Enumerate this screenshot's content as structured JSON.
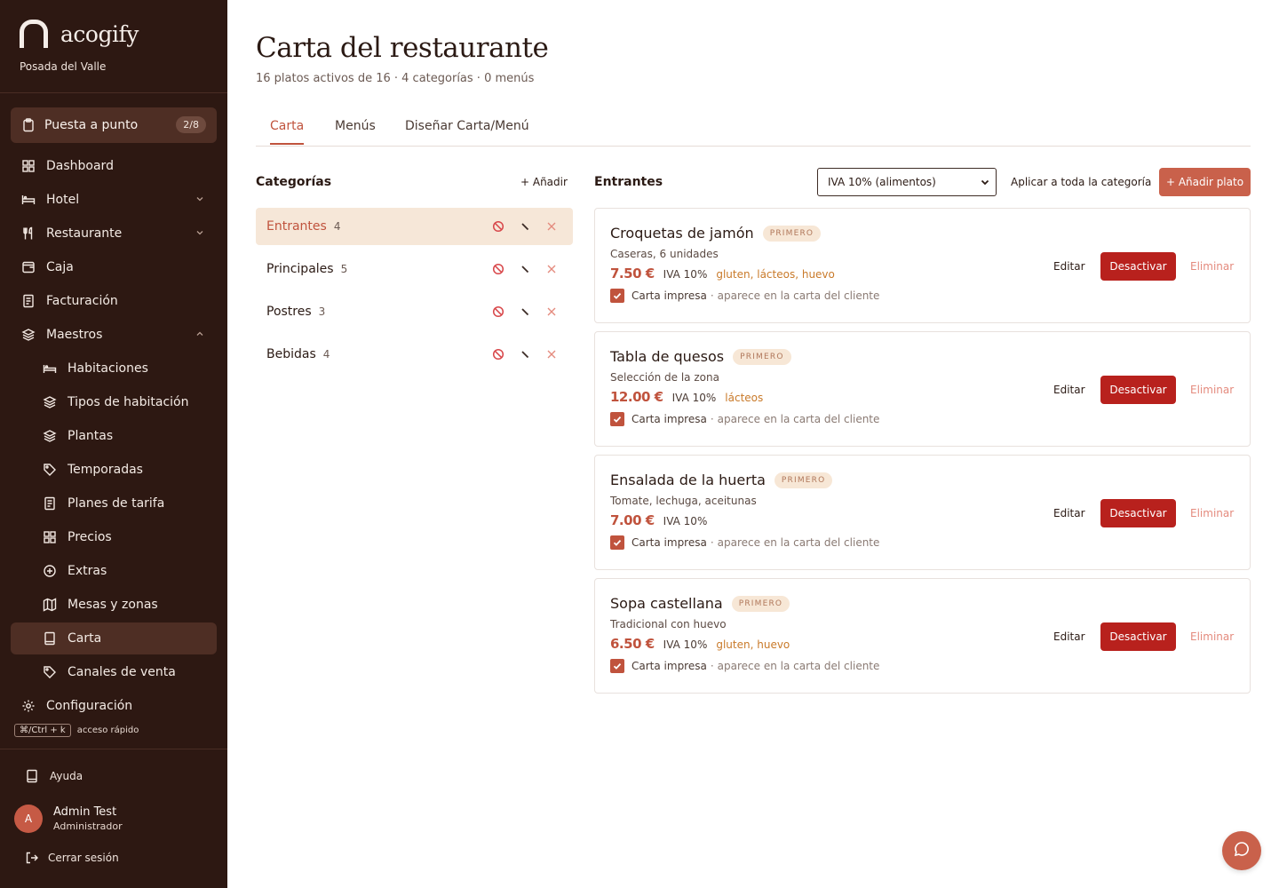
{
  "brand": {
    "name": "acogify",
    "hotel": "Posada del Valle"
  },
  "setup": {
    "label": "Puesta a punto",
    "badge": "2/8"
  },
  "nav": {
    "dashboard": "Dashboard",
    "hotel": "Hotel",
    "restaurante": "Restaurante",
    "caja": "Caja",
    "facturacion": "Facturación",
    "maestros": "Maestros",
    "habitaciones": "Habitaciones",
    "tipos": "Tipos de habitación",
    "plantas": "Plantas",
    "temporadas": "Temporadas",
    "planes": "Planes de tarifa",
    "precios": "Precios",
    "extras": "Extras",
    "mesas": "Mesas y zonas",
    "carta": "Carta",
    "canales": "Canales de venta",
    "configuracion": "Configuración"
  },
  "shortcut": {
    "keys": "⌘/Ctrl + k",
    "label": "acceso rápido"
  },
  "footer": {
    "help": "Ayuda",
    "user_initial": "A",
    "user_name": "Admin Test",
    "user_role": "Administrador",
    "logout": "Cerrar sesión"
  },
  "page": {
    "title": "Carta del restaurante",
    "subtitle": "16 platos activos de 16 · 4 categorías · 0 menús"
  },
  "tabs": [
    "Carta",
    "Menús",
    "Diseñar Carta/Menú"
  ],
  "categories": {
    "title": "Categorías",
    "add": "+ Añadir",
    "items": [
      {
        "name": "Entrantes",
        "count": "4"
      },
      {
        "name": "Principales",
        "count": "5"
      },
      {
        "name": "Postres",
        "count": "3"
      },
      {
        "name": "Bebidas",
        "count": "4"
      }
    ]
  },
  "dishes_panel": {
    "title": "Entrantes",
    "iva_select": "IVA 10% (alimentos)",
    "apply_all": "Aplicar a toda la categoría",
    "add_dish": "+ Añadir plato",
    "edit": "Editar",
    "deactivate": "Desactivar",
    "delete": "Eliminar",
    "print_label": "Carta impresa",
    "print_sep": "·",
    "print_hint": "aparece en la carta del cliente"
  },
  "dishes": [
    {
      "name": "Croquetas de jamón",
      "tag": "PRIMERO",
      "desc": "Caseras, 6 unidades",
      "price": "7.50 €",
      "iva": "IVA 10%",
      "allergens": "gluten, lácteos, huevo"
    },
    {
      "name": "Tabla de quesos",
      "tag": "PRIMERO",
      "desc": "Selección de la zona",
      "price": "12.00 €",
      "iva": "IVA 10%",
      "allergens": "lácteos"
    },
    {
      "name": "Ensalada de la huerta",
      "tag": "PRIMERO",
      "desc": "Tomate, lechuga, aceitunas",
      "price": "7.00 €",
      "iva": "IVA 10%",
      "allergens": ""
    },
    {
      "name": "Sopa castellana",
      "tag": "PRIMERO",
      "desc": "Tradicional con huevo",
      "price": "6.50 €",
      "iva": "IVA 10%",
      "allergens": "gluten, huevo"
    }
  ],
  "colors": {
    "sidebar": "#2d1812",
    "accent": "#c0533d",
    "danger": "#b8211d",
    "allergen": "#c97a2a"
  }
}
